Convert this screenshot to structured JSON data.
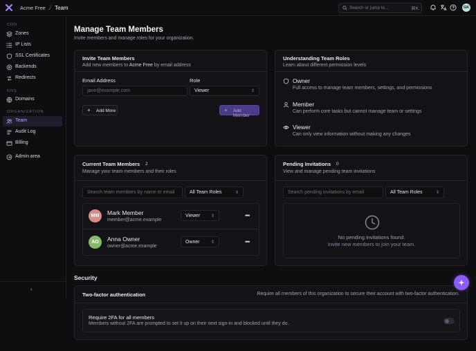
{
  "topbar": {
    "org": "Acme Free",
    "crumb": "Team",
    "search_placeholder": "Search or jump to...",
    "search_shortcut": "⌘K",
    "avatar_initials": "GK"
  },
  "sidebar": {
    "sections": [
      {
        "label": "CDN"
      },
      {
        "label": "DNS"
      },
      {
        "label": "ORGANIZATION"
      }
    ],
    "items": [
      {
        "label": "Zones",
        "icon": "zones-icon"
      },
      {
        "label": "IP Lists",
        "icon": "list-icon"
      },
      {
        "label": "SSL Certificates",
        "icon": "shield-icon"
      },
      {
        "label": "Backends",
        "icon": "server-icon"
      },
      {
        "label": "Redirects",
        "icon": "redirect-icon"
      },
      {
        "label": "Domains",
        "icon": "globe-icon"
      },
      {
        "label": "Team",
        "icon": "users-icon",
        "active": true
      },
      {
        "label": "Audit Log",
        "icon": "log-icon"
      },
      {
        "label": "Billing",
        "icon": "card-icon"
      },
      {
        "label": "Admin area",
        "icon": "admin-icon"
      }
    ]
  },
  "page": {
    "title": "Manage Team Members",
    "subtitle": "Invite members and manage roles for your organization."
  },
  "invite": {
    "title": "Invite Team Members",
    "subtitle_prefix": "Add new members to ",
    "subtitle_org": "Acme Free",
    "subtitle_suffix": " by email address",
    "email_label": "Email Address",
    "email_placeholder": "jane@example.com",
    "role_label": "Role",
    "role_value": "Viewer",
    "add_more": "Add More",
    "add_member": "Add Member"
  },
  "roles": {
    "title": "Understanding Team Roles",
    "subtitle": "Learn about different permission levels",
    "items": [
      {
        "name": "Owner",
        "desc": "Full access to manage team members, settings, and permissions"
      },
      {
        "name": "Member",
        "desc": "Can perform core tasks but cannot manage team or settings"
      },
      {
        "name": "Viewer",
        "desc": "Can only view information without making any changes"
      }
    ]
  },
  "current": {
    "title": "Current Team Members",
    "count": "2",
    "subtitle": "Manage your team members and their roles",
    "search_placeholder": "Search team members by name or email",
    "filter": "All Team Roles",
    "members": [
      {
        "initials": "MM",
        "name": "Mark Member",
        "email": "member@acme.example",
        "role": "Viewer",
        "color": "#d98a8a"
      },
      {
        "initials": "AO",
        "name": "Anna Owner",
        "email": "owner@acme.example",
        "role": "Owner",
        "color": "#8ab86a"
      }
    ]
  },
  "pending": {
    "title": "Pending Invitations",
    "count": "0",
    "subtitle": "View and manage pending team invitations",
    "search_placeholder": "Search pending invitations by email",
    "filter": "All Team Roles",
    "empty_title": "No pending invitations found.",
    "empty_sub": "Invite new members to join your team."
  },
  "security": {
    "section": "Security",
    "twofa_title": "Two-factor authentication",
    "twofa_desc": "Require all members of this organization to secure their account with two-factor authentication.",
    "require_title": "Require 2FA for all members",
    "require_desc": "Members without 2FA are prompted to set it up on their next sign-in and blocked until they do.",
    "require_enabled": false
  },
  "colors": {
    "accent": "#8b5cf6",
    "background": "#0e0e11",
    "card": "#131317"
  }
}
